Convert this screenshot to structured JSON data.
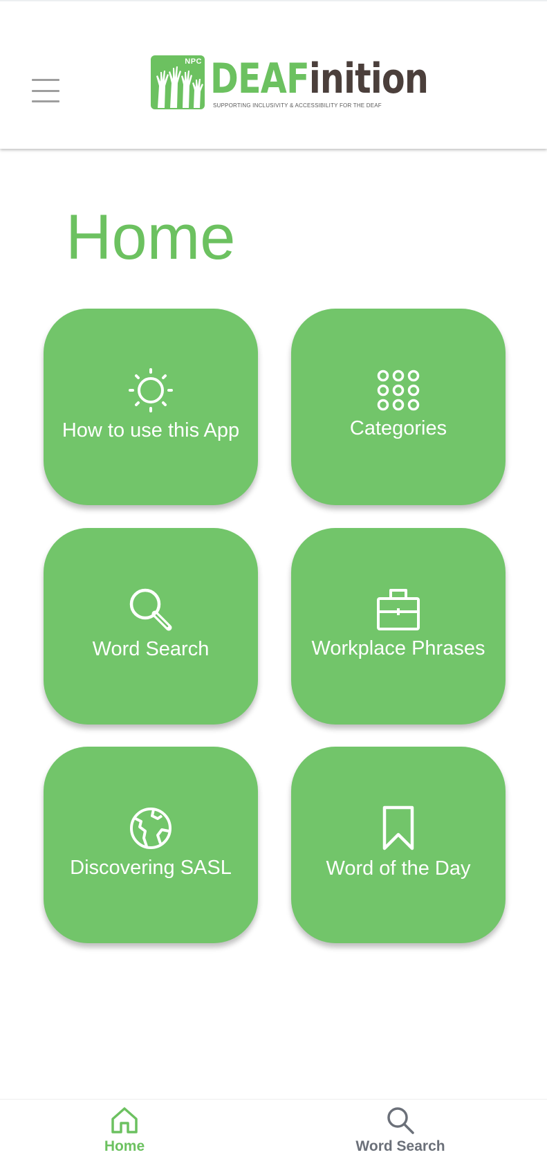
{
  "header": {
    "logo": {
      "badge": "NPC",
      "name_part1": "DEAF",
      "name_part2": "inition",
      "tagline": "SUPPORTING INCLUSIVITY & ACCESSIBILITY FOR THE DEAF"
    },
    "menu_icon": "hamburger-menu-icon"
  },
  "page": {
    "title": "Home"
  },
  "tiles": [
    {
      "label": "How to use this App",
      "icon": "sun-icon"
    },
    {
      "label": "Categories",
      "icon": "grid-dots-icon"
    },
    {
      "label": "Word Search",
      "icon": "search-icon"
    },
    {
      "label": "Workplace Phrases",
      "icon": "briefcase-icon"
    },
    {
      "label": "Discovering SASL",
      "icon": "globe-icon"
    },
    {
      "label": "Word of the Day",
      "icon": "bookmark-icon"
    }
  ],
  "bottom_nav": {
    "items": [
      {
        "label": "Home",
        "icon": "home-icon",
        "active": true
      },
      {
        "label": "Word Search",
        "icon": "search-icon",
        "active": false
      }
    ]
  },
  "colors": {
    "brand_green": "#6cc160",
    "tile_green": "#72c56a",
    "logo_dark": "#4b3f3b",
    "nav_inactive": "#6b7079",
    "menu_gray": "#9e9e9e"
  }
}
